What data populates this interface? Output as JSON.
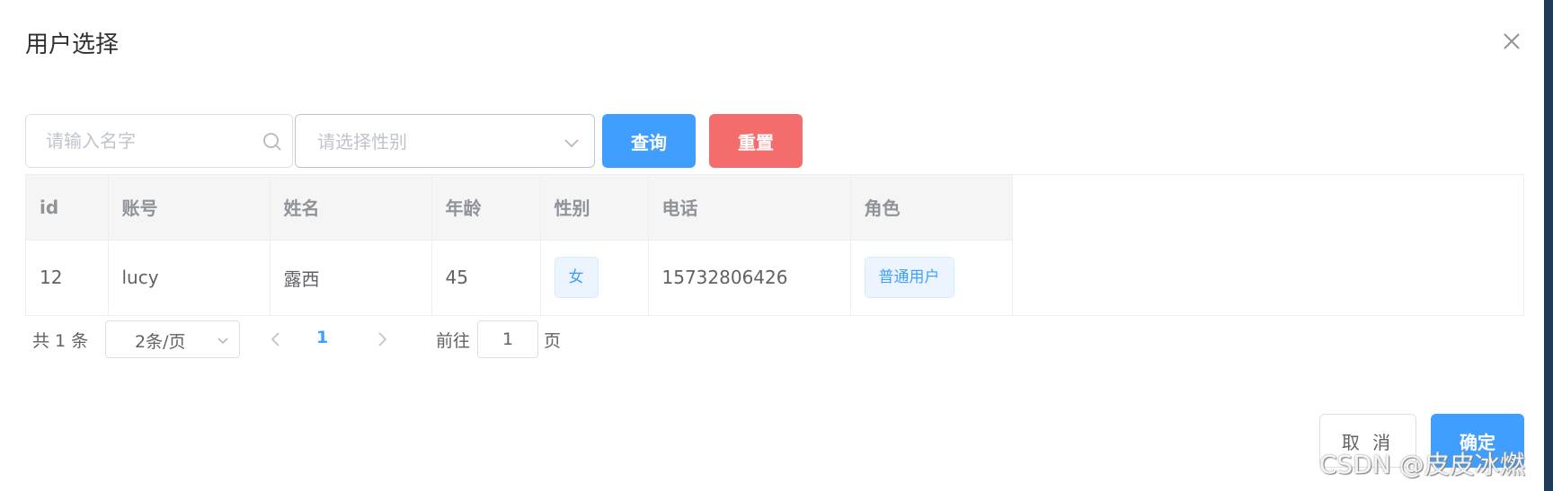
{
  "dialog": {
    "title": "用户选择"
  },
  "filters": {
    "name_placeholder": "请输入名字",
    "gender_placeholder": "请选择性别",
    "query_label": "查询",
    "reset_label": "重置"
  },
  "table": {
    "columns": [
      "id",
      "账号",
      "姓名",
      "年龄",
      "性别",
      "电话",
      "角色"
    ],
    "rows": [
      {
        "id": "12",
        "account": "lucy",
        "name": "露西",
        "age": "45",
        "gender": "女",
        "phone": "15732806426",
        "role": "普通用户"
      }
    ]
  },
  "pagination": {
    "total_text": "共 1 条",
    "page_size_label": "2条/页",
    "current_page": "1",
    "goto_label": "前往",
    "goto_value": "1",
    "page_suffix": "页"
  },
  "footer": {
    "cancel_label": "取 消",
    "confirm_label": "确定"
  },
  "watermark": "CSDN @皮皮冰燃",
  "colors": {
    "primary": "#409eff",
    "danger": "#f56c6c",
    "header_bg": "#f5f5f5",
    "border": "#ebeef5"
  },
  "icons": {
    "close": "close-icon",
    "search": "search-icon",
    "select_arrow": "chevron-down-icon",
    "prev": "chevron-left-icon",
    "next": "chevron-right-icon"
  }
}
